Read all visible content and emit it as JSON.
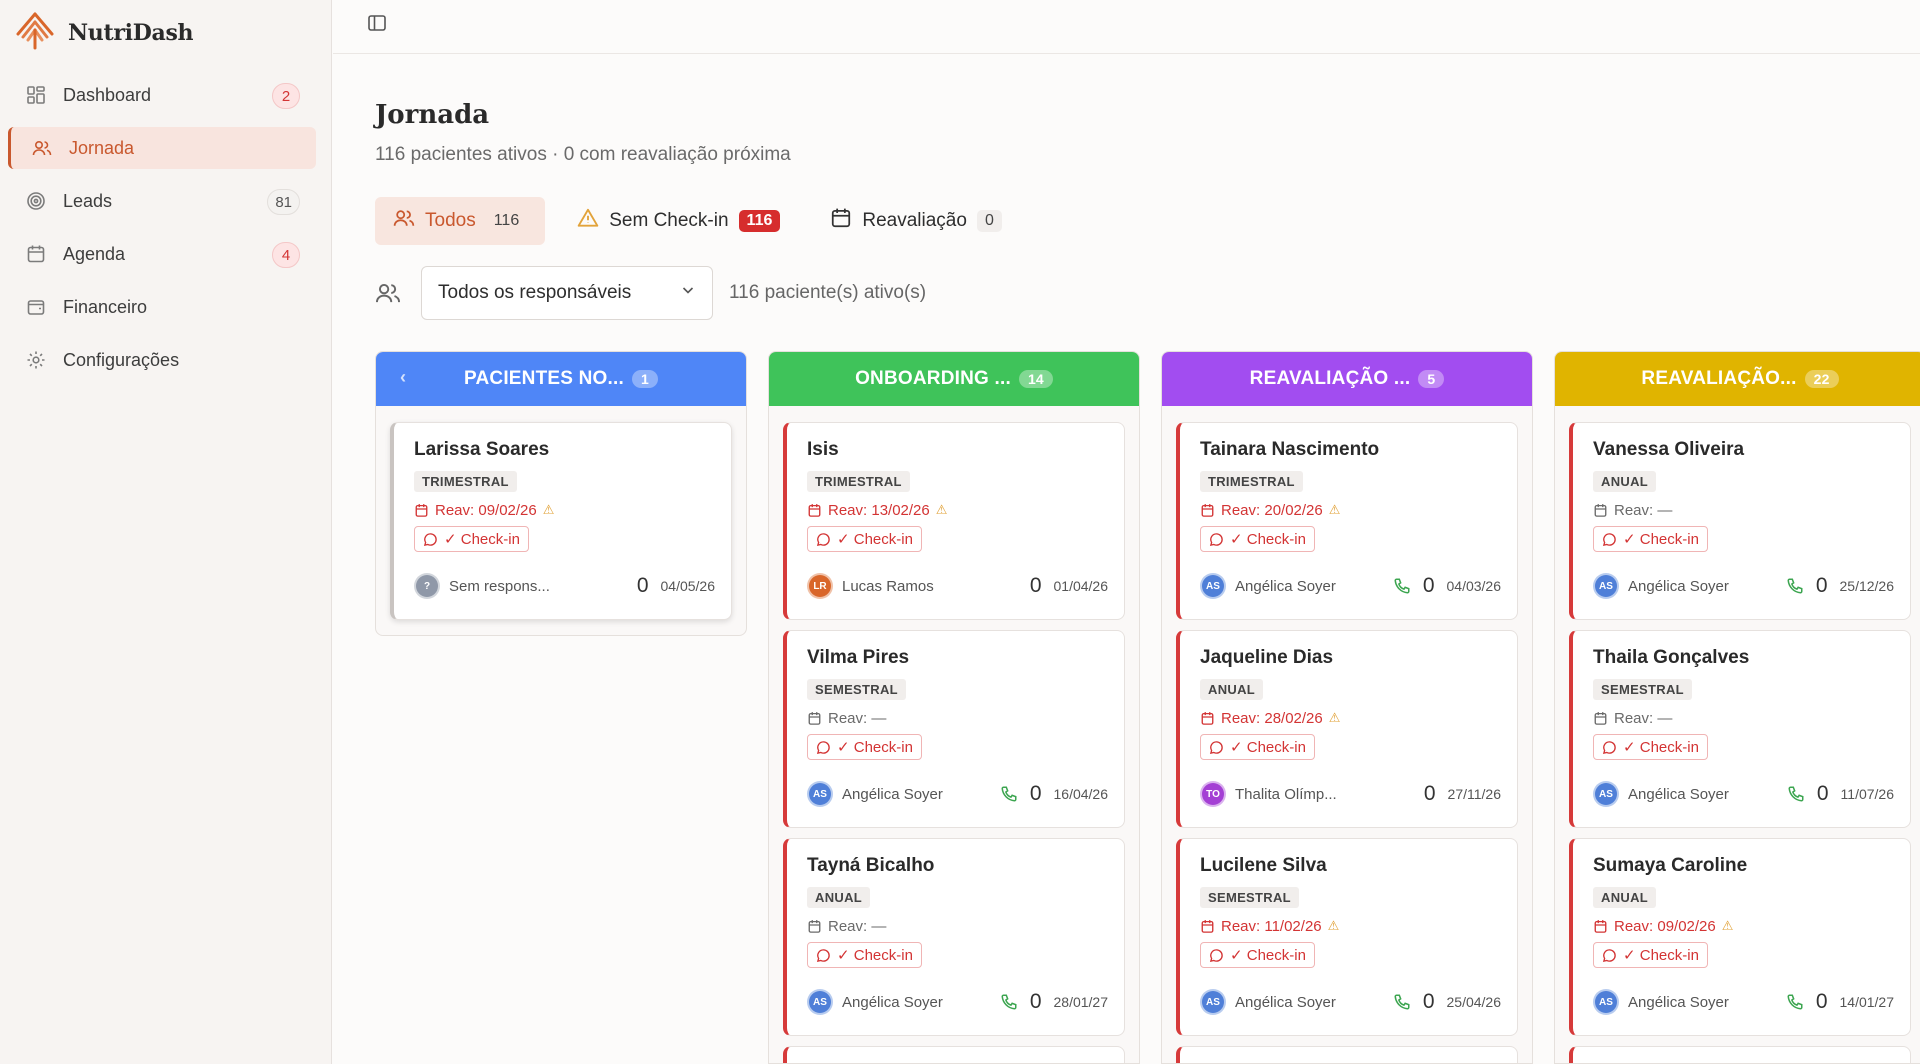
{
  "brand": {
    "name": "NutriDash"
  },
  "colors": {
    "accent": "#c9582e",
    "danger": "#d33434"
  },
  "sidebar": {
    "items": [
      {
        "label": "Dashboard",
        "icon": "grid-icon",
        "badge": "2",
        "badge_style": "red"
      },
      {
        "label": "Jornada",
        "icon": "users-icon",
        "badge": "",
        "active": true
      },
      {
        "label": "Leads",
        "icon": "target-icon",
        "badge": "81",
        "badge_style": "gray"
      },
      {
        "label": "Agenda",
        "icon": "calendar-icon",
        "badge": "4",
        "badge_style": "red"
      },
      {
        "label": "Financeiro",
        "icon": "wallet-icon",
        "badge": ""
      },
      {
        "label": "Configurações",
        "icon": "gear-icon",
        "badge": ""
      }
    ]
  },
  "page": {
    "title": "Jornada",
    "subtitle": "116 pacientes ativos · 0 com reavaliação próxima"
  },
  "filters": {
    "tabs": [
      {
        "label": "Todos",
        "count": "116",
        "icon": "users-icon",
        "active": true
      },
      {
        "label": "Sem Check-in",
        "count": "116",
        "icon": "warning-icon"
      },
      {
        "label": "Reavaliação",
        "count": "0",
        "icon": "calendar-icon"
      }
    ],
    "responsible_select": "Todos os responsáveis",
    "active_count": "116 paciente(s) ativo(s)"
  },
  "board": {
    "columns": [
      {
        "title": "PACIENTES NO...",
        "count": "1",
        "color": "#4f86f7",
        "cards": [
          {
            "name": "Larissa Soares",
            "plan": "TRIMESTRAL",
            "reav": "Reav: 09/02/26",
            "reav_warn": true,
            "checkin": "✓ Check-in",
            "avatar": "?",
            "avatar_color": "#8f98a8",
            "owner": "Sem respons...",
            "phone": false,
            "score": "0",
            "date": "04/05/26"
          }
        ]
      },
      {
        "title": "ONBOARDING ...",
        "count": "14",
        "color": "#3fc35a",
        "cards": [
          {
            "name": "Isis",
            "plan": "TRIMESTRAL",
            "reav": "Reav: 13/02/26",
            "reav_warn": true,
            "checkin": "✓ Check-in",
            "avatar": "LR",
            "avatar_color": "#d9662a",
            "owner": "Lucas Ramos",
            "phone": false,
            "score": "0",
            "date": "01/04/26"
          },
          {
            "name": "Vilma Pires",
            "plan": "SEMESTRAL",
            "reav": "Reav: —",
            "reav_warn": false,
            "checkin": "✓ Check-in",
            "avatar": "AS",
            "avatar_color": "#4f7fd8",
            "owner": "Angélica Soyer",
            "phone": true,
            "score": "0",
            "date": "16/04/26"
          },
          {
            "name": "Tayná Bicalho",
            "plan": "ANUAL",
            "reav": "Reav: —",
            "reav_warn": false,
            "checkin": "✓ Check-in",
            "avatar": "AS",
            "avatar_color": "#4f7fd8",
            "owner": "Angélica Soyer",
            "phone": true,
            "score": "0",
            "date": "28/01/27"
          }
        ]
      },
      {
        "title": "REAVALIAÇÃO ...",
        "count": "5",
        "color": "#a24df0",
        "cards": [
          {
            "name": "Tainara Nascimento",
            "plan": "TRIMESTRAL",
            "reav": "Reav: 20/02/26",
            "reav_warn": true,
            "checkin": "✓ Check-in",
            "avatar": "AS",
            "avatar_color": "#4f7fd8",
            "owner": "Angélica Soyer",
            "phone": true,
            "score": "0",
            "date": "04/03/26"
          },
          {
            "name": "Jaqueline Dias",
            "plan": "ANUAL",
            "reav": "Reav: 28/02/26",
            "reav_warn": true,
            "checkin": "✓ Check-in",
            "avatar": "TO",
            "avatar_color": "#a43fd4",
            "owner": "Thalita Olímp...",
            "phone": false,
            "score": "0",
            "date": "27/11/26"
          },
          {
            "name": "Lucilene Silva",
            "plan": "SEMESTRAL",
            "reav": "Reav: 11/02/26",
            "reav_warn": true,
            "checkin": "✓ Check-in",
            "avatar": "AS",
            "avatar_color": "#4f7fd8",
            "owner": "Angélica Soyer",
            "phone": true,
            "score": "0",
            "date": "25/04/26"
          }
        ]
      },
      {
        "title": "REAVALIAÇÃO...",
        "count": "22",
        "color": "#e0b400",
        "cards": [
          {
            "name": "Vanessa Oliveira",
            "plan": "ANUAL",
            "reav": "Reav: —",
            "reav_warn": false,
            "checkin": "✓ Check-in",
            "avatar": "AS",
            "avatar_color": "#4f7fd8",
            "owner": "Angélica Soyer",
            "phone": true,
            "score": "0",
            "date": "25/12/26"
          },
          {
            "name": "Thaila Gonçalves",
            "plan": "SEMESTRAL",
            "reav": "Reav: —",
            "reav_warn": false,
            "checkin": "✓ Check-in",
            "avatar": "AS",
            "avatar_color": "#4f7fd8",
            "owner": "Angélica Soyer",
            "phone": true,
            "score": "0",
            "date": "11/07/26"
          },
          {
            "name": "Sumaya Caroline",
            "plan": "ANUAL",
            "reav": "Reav: 09/02/26",
            "reav_warn": true,
            "checkin": "✓ Check-in",
            "avatar": "AS",
            "avatar_color": "#4f7fd8",
            "owner": "Angélica Soyer",
            "phone": true,
            "score": "0",
            "date": "14/01/27"
          }
        ]
      }
    ]
  }
}
